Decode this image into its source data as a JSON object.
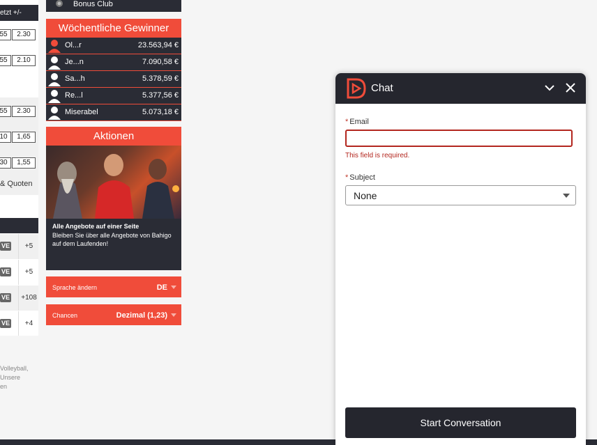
{
  "left_column": {
    "header_label": "etzt +/-",
    "odds_rows": [
      {
        "a": "55",
        "b": "2.30"
      },
      {
        "a": "55",
        "b": "2.10"
      },
      {
        "a": "55",
        "b": "2.30"
      },
      {
        "a": "10",
        "b": "1,65"
      },
      {
        "a": "30",
        "b": "1,55"
      }
    ],
    "quoten_label": "& Quoten",
    "live_rows": [
      {
        "badge": "VE",
        "count": "+5"
      },
      {
        "badge": "VE",
        "count": "+5"
      },
      {
        "badge": "VE",
        "count": "+108"
      },
      {
        "badge": "VE",
        "count": "+4"
      }
    ],
    "footer_lines": [
      "Volleyball,",
      "Unsere",
      "en"
    ]
  },
  "middle": {
    "bonus_club": "Bonus Club",
    "winners_title": "Wöchentliche Gewinner",
    "winners": [
      {
        "name": "Ol...r",
        "amount": "23.563,94 €"
      },
      {
        "name": "Je...n",
        "amount": "7.090,58 €"
      },
      {
        "name": "Sa...h",
        "amount": "5.378,59 €"
      },
      {
        "name": "Re...l",
        "amount": "5.377,56 €"
      },
      {
        "name": "Miserabel",
        "amount": "5.073,18 €"
      }
    ],
    "actions_title": "Aktionen",
    "promo_heading": "Alle Angebote auf einer Seite",
    "promo_body": "Bleiben Sie über alle Angebote von Bahigo auf dem Laufenden!",
    "language_label": "Sprache ändern",
    "language_value": "DE",
    "odds_label": "Chancen",
    "odds_value": "Dezimal (1,23)"
  },
  "chat": {
    "title": "Chat",
    "email_label": "Email",
    "email_value": "",
    "email_error": "This field is required.",
    "subject_label": "Subject",
    "subject_value": "None",
    "start_button": "Start Conversation",
    "required_mark": "*"
  },
  "colors": {
    "accent": "#f04c3a",
    "dark": "#25262e",
    "error": "#b3261e"
  }
}
